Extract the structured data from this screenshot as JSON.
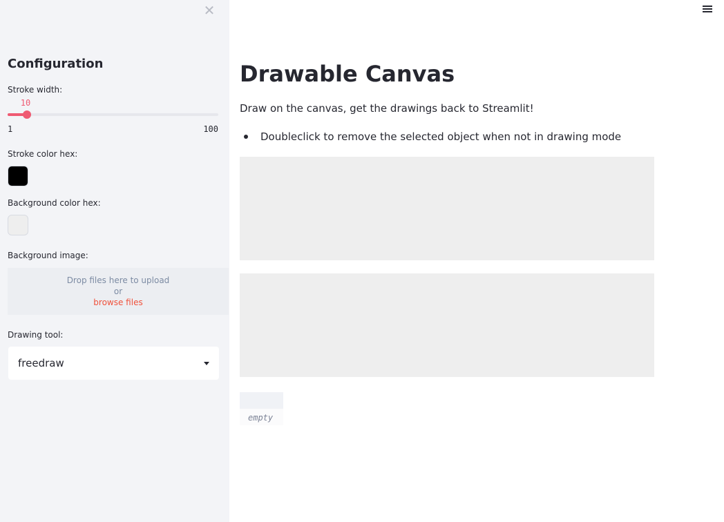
{
  "sidebar": {
    "close_icon": "close-icon",
    "heading": "Configuration",
    "stroke_width": {
      "label": "Stroke width:",
      "value": 10,
      "value_text": "10",
      "min_text": "1",
      "max_text": "100",
      "fraction": 0.0909
    },
    "stroke_color": {
      "label": "Stroke color hex:",
      "value": "#000000"
    },
    "background_color": {
      "label": "Background color hex:",
      "value": "#eeeeee"
    },
    "background_image": {
      "label": "Background image:",
      "drop_text": "Drop files here to upload",
      "or_text": "or",
      "browse_text": "browse files"
    },
    "drawing_tool": {
      "label": "Drawing tool:",
      "selected": "freedraw"
    }
  },
  "main": {
    "menu_icon": "hamburger-icon",
    "title": "Drawable Canvas",
    "description": "Draw on the canvas, get the drawings back to Streamlit!",
    "bullets": [
      "Doubleclick to remove the selected object when not in drawing mode"
    ],
    "empty_label": "empty"
  },
  "colors": {
    "accent": "#ef5a72",
    "link": "#f0513b",
    "canvas_bg": "#eeeeee",
    "sidebar_bg": "#f3f4f7"
  }
}
